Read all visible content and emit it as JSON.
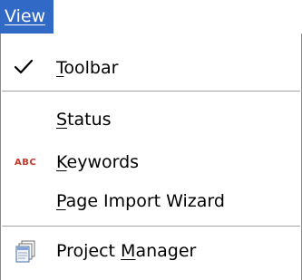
{
  "menubar": {
    "tab_label": "View"
  },
  "menu": {
    "items": [
      {
        "label": "Toolbar",
        "checked": true,
        "icon": "checkmark-icon"
      },
      {
        "label": "Status"
      },
      {
        "label": "Keywords",
        "icon": "spellcheck-abc-icon"
      },
      {
        "label": "Page Import Wizard"
      },
      {
        "label": "Project Manager",
        "icon": "project-manager-icon"
      }
    ]
  },
  "colors": {
    "menubar_highlight": "#3169c6",
    "menu_background": "#ffffff",
    "separator": "#a6a6a6",
    "abc_icon_red": "#c0392b"
  }
}
